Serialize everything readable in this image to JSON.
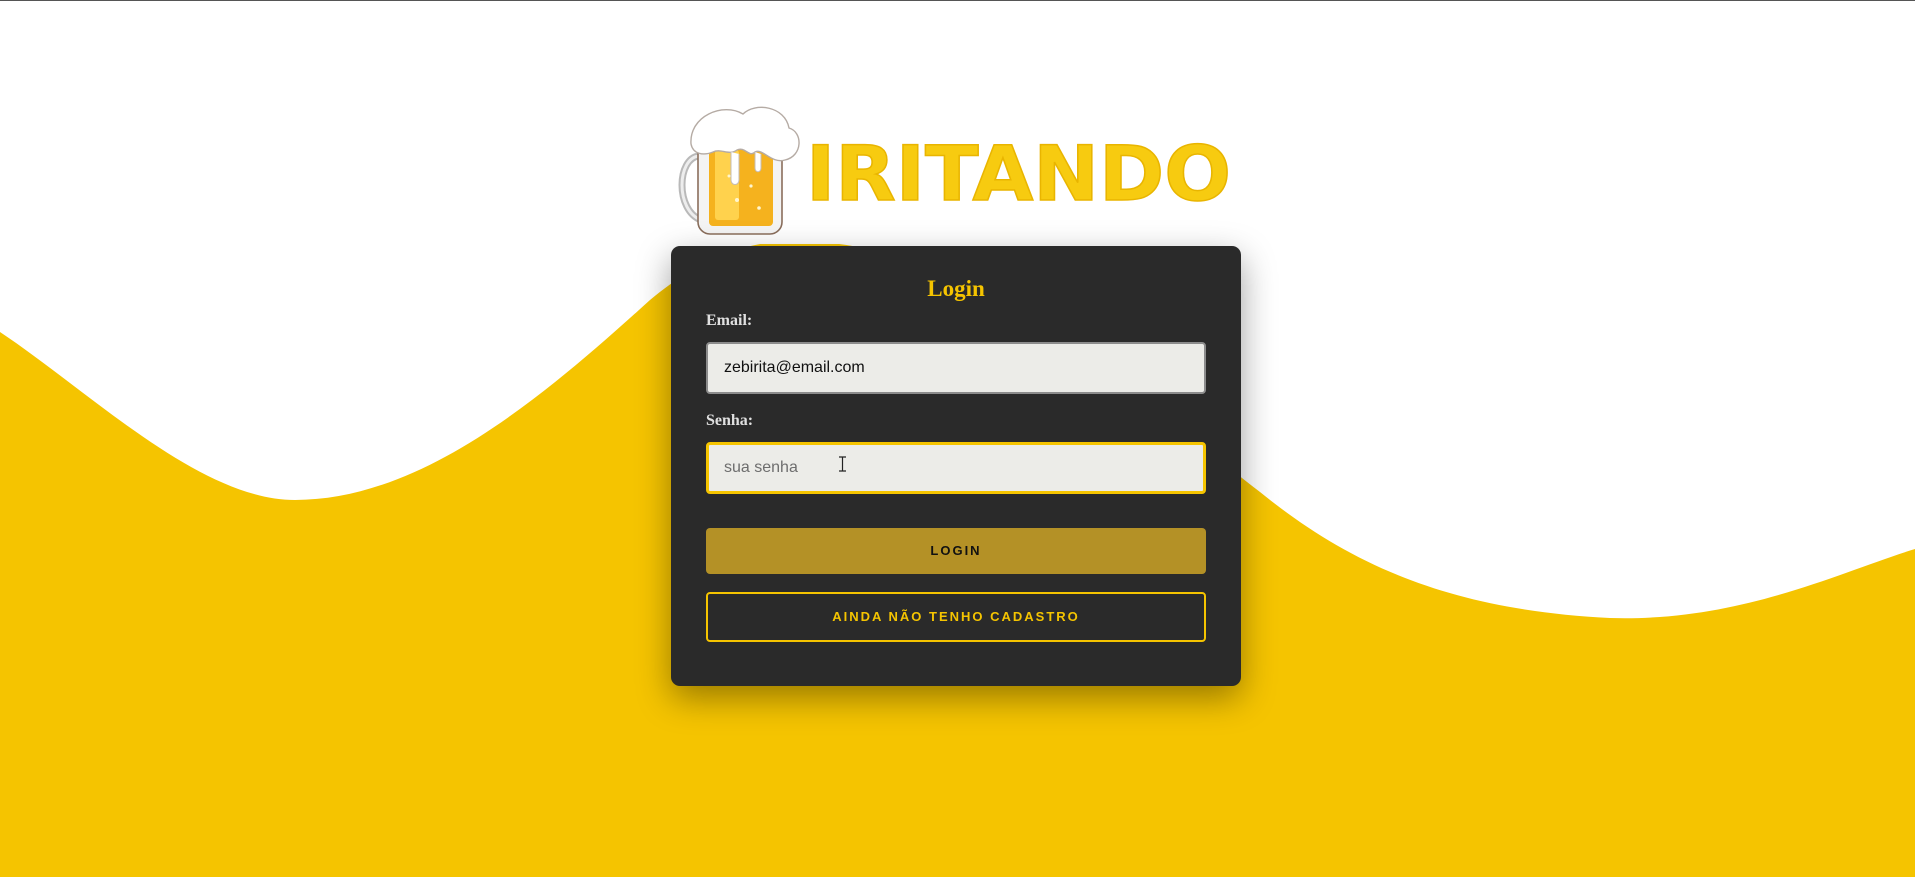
{
  "colors": {
    "accent": "#f5c400",
    "card_background": "#2a2a2a",
    "login_button": "#b49126",
    "input_background": "#ecece8",
    "label_text": "#e0e0e0"
  },
  "logo": {
    "text": "IRITANDO",
    "icon": "beer-mug-icon"
  },
  "login_card": {
    "title": "Login",
    "email_label": "Email:",
    "email_value": "zebirita@email.com",
    "password_label": "Senha:",
    "password_placeholder": "sua senha",
    "login_button": "LOGIN",
    "register_button": "AINDA NÃO TENHO CADASTRO"
  },
  "cursor": {
    "icon": "text-cursor-icon"
  }
}
